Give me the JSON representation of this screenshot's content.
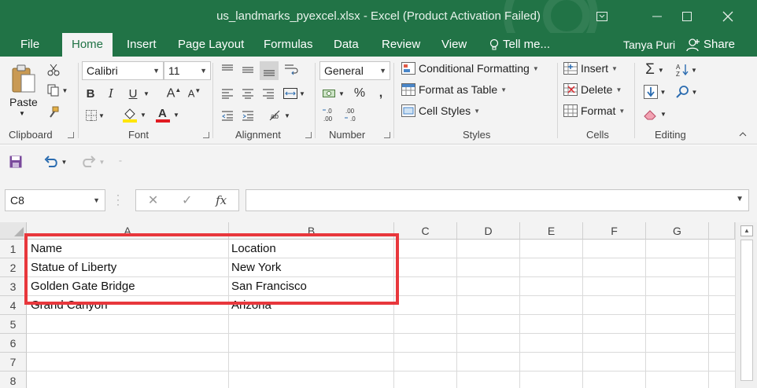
{
  "window": {
    "title": "us_landmarks_pyexcel.xlsx - Excel (Product Activation Failed)"
  },
  "tabs": [
    {
      "label": "File"
    },
    {
      "label": "Home"
    },
    {
      "label": "Insert"
    },
    {
      "label": "Page Layout"
    },
    {
      "label": "Formulas"
    },
    {
      "label": "Data"
    },
    {
      "label": "Review"
    },
    {
      "label": "View"
    },
    {
      "label": "Tell me..."
    }
  ],
  "user": {
    "name": "Tanya Puri",
    "share_label": "Share"
  },
  "ribbon": {
    "clipboard": {
      "paste_label": "Paste",
      "group_label": "Clipboard"
    },
    "font": {
      "name": "Calibri",
      "size": "11",
      "group_label": "Font",
      "bold": "B",
      "italic": "I",
      "underline": "U"
    },
    "alignment": {
      "group_label": "Alignment"
    },
    "number": {
      "format": "General",
      "group_label": "Number",
      "percent": "%",
      "comma": ","
    },
    "styles": {
      "conditional_formatting": "Conditional Formatting",
      "format_as_table": "Format as Table",
      "cell_styles": "Cell Styles",
      "group_label": "Styles"
    },
    "cells": {
      "insert": "Insert",
      "delete": "Delete",
      "format": "Format",
      "group_label": "Cells"
    },
    "editing": {
      "group_label": "Editing"
    }
  },
  "formula_bar": {
    "name_box": "C8",
    "fx_label": "fx",
    "cancel": "✕",
    "enter": "✓",
    "formula": ""
  },
  "sheet": {
    "columns": [
      "A",
      "B",
      "C",
      "D",
      "E",
      "F",
      "G"
    ],
    "rows": [
      "1",
      "2",
      "3",
      "4",
      "5",
      "6",
      "7",
      "8"
    ],
    "cells": [
      {
        "a": "Name",
        "b": "Location"
      },
      {
        "a": "Statue of Liberty",
        "b": "New York"
      },
      {
        "a": "Golden Gate Bridge",
        "b": "San Francisco"
      },
      {
        "a": "Grand Canyon",
        "b": "Arizona"
      }
    ]
  },
  "colors": {
    "excel_green": "#217346",
    "highlight_red": "#e8373c"
  }
}
